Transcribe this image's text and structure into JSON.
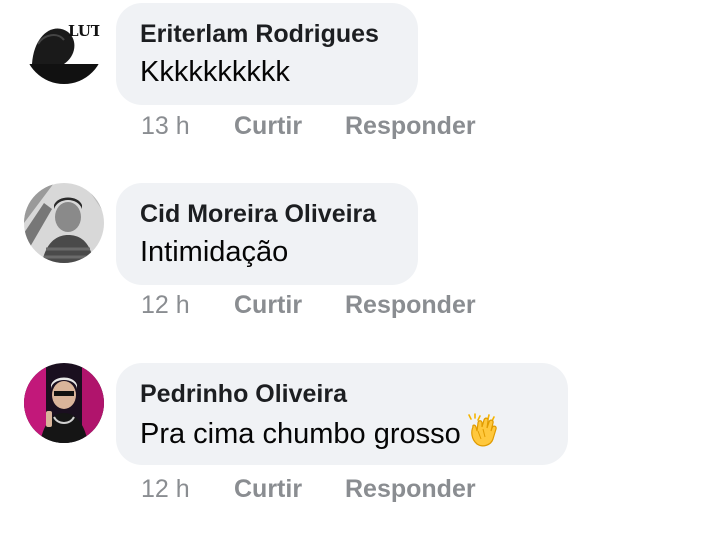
{
  "comments": [
    {
      "author": "Eriterlam Rodrigues",
      "text": "Kkkkkkkkkk",
      "time": "13 h",
      "like_label": "Curtir",
      "reply_label": "Responder",
      "avatar_badge": "LUTO"
    },
    {
      "author": "Cid Moreira Oliveira",
      "text": "Intimidação",
      "time": "12 h",
      "like_label": "Curtir",
      "reply_label": "Responder"
    },
    {
      "author": "Pedrinho Oliveira",
      "text": "Pra cima chumbo grosso",
      "emoji": "clapping-hands-icon",
      "time": "12 h",
      "like_label": "Curtir",
      "reply_label": "Responder"
    }
  ],
  "colors": {
    "bubble_bg": "#f0f2f5",
    "meta_text": "#8a8d91",
    "author_text": "#1c1e21"
  }
}
